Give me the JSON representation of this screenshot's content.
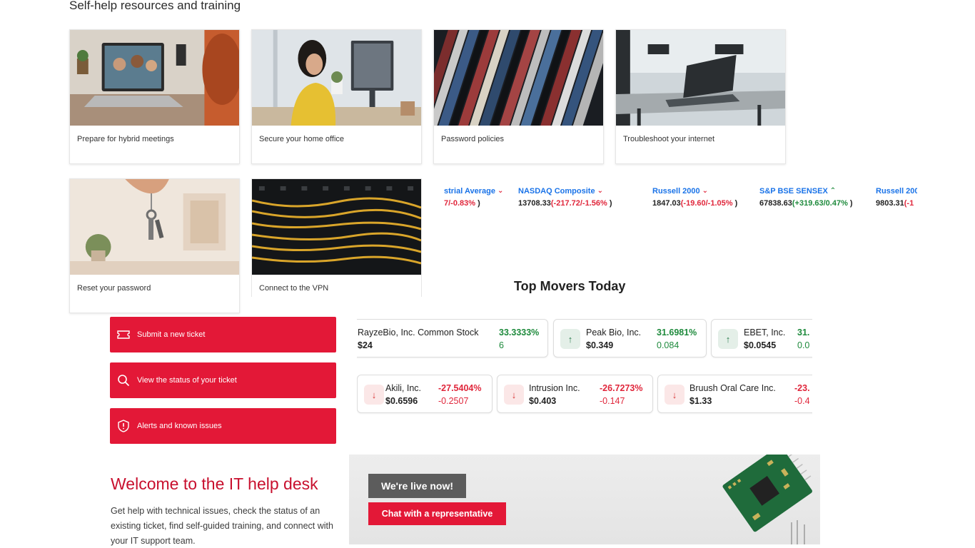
{
  "section_title": "Self-help resources and training",
  "cards": [
    {
      "label": "Prepare for hybrid meetings"
    },
    {
      "label": "Secure your home office"
    },
    {
      "label": "Password policies"
    },
    {
      "label": "Troubleshoot your internet"
    },
    {
      "label": "Reset your password"
    },
    {
      "label": "Connect to the VPN"
    }
  ],
  "ticker": [
    {
      "name": "strial Average",
      "value": "",
      "change": "7/-0.83%",
      "suffix": " )",
      "direction": "down"
    },
    {
      "name": "NASDAQ Composite",
      "value": "13708.33",
      "change": "(-217.72/-1.56%",
      "suffix": " )",
      "direction": "down"
    },
    {
      "name": "Russell 2000",
      "value": "1847.03",
      "change": "(-19.60/-1.05%",
      "suffix": " )",
      "direction": "down"
    },
    {
      "name": "S&P BSE SENSEX",
      "value": "67838.63",
      "change": "(+319.63/0.47%",
      "suffix": " )",
      "direction": "up"
    },
    {
      "name": "Russell 200",
      "value": "9803.31",
      "change": "(-1",
      "suffix": "",
      "direction": "none"
    }
  ],
  "movers_title": "Top Movers Today",
  "movers_up": [
    {
      "name": "RayzeBio, Inc. Common Stock",
      "price": "$24",
      "pct": "33.3333%",
      "change": "6"
    },
    {
      "name": "Peak Bio, Inc.",
      "price": "$0.349",
      "pct": "31.6981%",
      "change": "0.084"
    },
    {
      "name": "EBET, Inc.",
      "price": "$0.0545",
      "pct": "31.",
      "change": "0.0"
    }
  ],
  "movers_down": [
    {
      "name": "Akili, Inc.",
      "price": "$0.6596",
      "pct": "-27.5404%",
      "change": "-0.2507"
    },
    {
      "name": "Intrusion Inc.",
      "price": "$0.403",
      "pct": "-26.7273%",
      "change": "-0.147"
    },
    {
      "name": "Bruush Oral Care Inc.",
      "price": "$1.33",
      "pct": "-23.",
      "change": "-0.4"
    }
  ],
  "actions": [
    {
      "label": "Submit a new ticket",
      "icon": "ticket-icon"
    },
    {
      "label": "View the status of your ticket",
      "icon": "search-icon"
    },
    {
      "label": "Alerts and known issues",
      "icon": "shield-alert-icon"
    }
  ],
  "welcome": {
    "title": "Welcome to the IT help desk",
    "body": "Get help with technical issues, check the status of an existing ticket, find self-guided training, and connect with your IT support team."
  },
  "live_chat": {
    "tag": "We're live now!",
    "button": "Chat with a representative"
  },
  "colors": {
    "brand_red": "#e31837",
    "heading_red": "#c8102e",
    "link_blue": "#1a73e8",
    "up_green": "#1e8a3c",
    "down_red": "#e0263b"
  }
}
